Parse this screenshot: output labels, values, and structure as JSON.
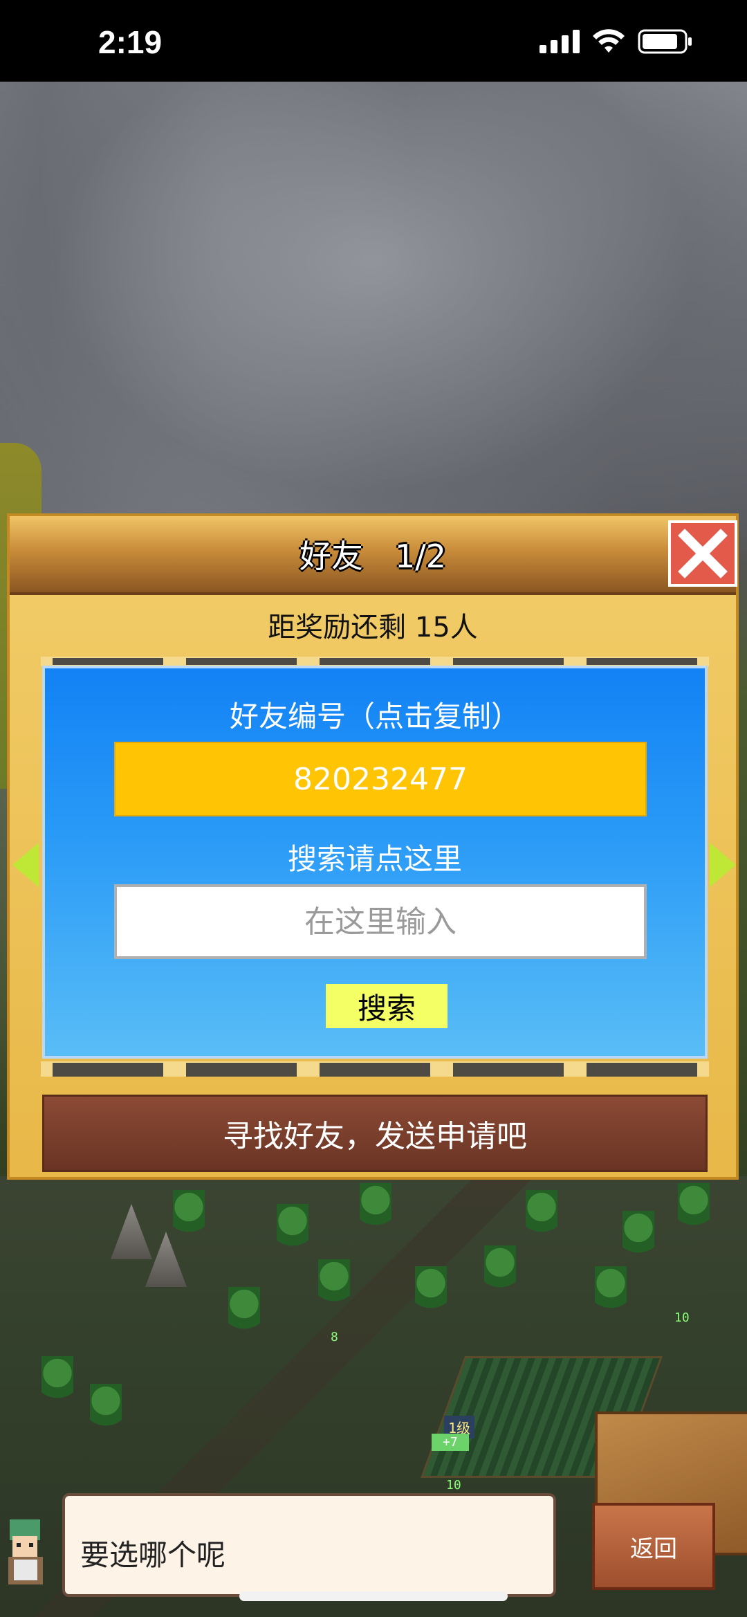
{
  "status": {
    "time": "2:19",
    "icons": [
      "cellular-icon",
      "wifi-icon",
      "battery-icon"
    ]
  },
  "dialog": {
    "title": "好友　1/2",
    "reward_text": "距奖励还剩 15人",
    "friend_id_label": "好友编号（点击复制）",
    "friend_id": "820232477",
    "search_label": "搜索请点这里",
    "search_placeholder": "在这里输入",
    "search_button": "搜索",
    "find_button": "寻找好友，发送申请吧"
  },
  "bottom": {
    "speech": "要选哪个呢",
    "back_button": "返回"
  },
  "map_labels": {
    "level_label": "1级",
    "counter_label": "+7",
    "tag_a": "8",
    "tag_b": "10",
    "tag_c": "10"
  },
  "colors": {
    "panel_blue": "#1282f5",
    "id_yellow": "#ffc505",
    "close_red": "#e35a4a",
    "find_brown": "#7a3d2b"
  }
}
